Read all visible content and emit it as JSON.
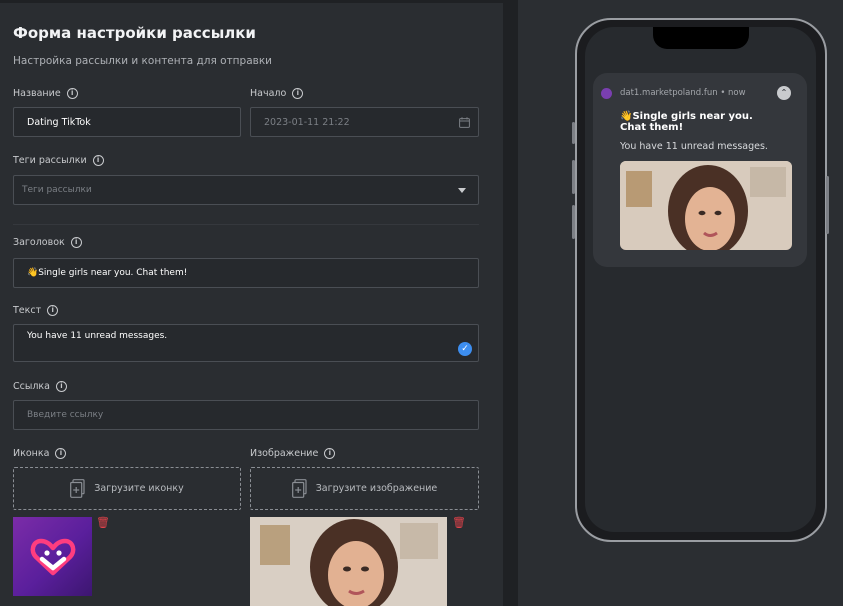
{
  "form": {
    "title": "Форма настройки рассылки",
    "subtitle": "Настройка рассылки и контента для отправки",
    "name_label": "Название",
    "name_value": "Dating TikTok",
    "start_label": "Начало",
    "start_placeholder": "2023-01-11 21:22",
    "tags_label": "Теги рассылки",
    "tags_placeholder": "Теги рассылки",
    "header_label": "Заголовок",
    "header_value": "👋Single girls near you. Chat them!",
    "text_label": "Текст",
    "text_value": "You have 11 unread messages.",
    "link_label": "Ссылка",
    "link_placeholder": "Введите ссылку",
    "icon_label": "Иконка",
    "icon_upload": "Загрузите иконку",
    "image_label": "Изображение",
    "image_upload": "Загрузите изображение"
  },
  "preview": {
    "source": "dat1.marketpoland.fun • now",
    "title": "👋Single girls near you. Chat them!",
    "body": "You have 11 unread messages."
  },
  "icons": {
    "info": "info-icon",
    "calendar": "calendar-icon",
    "dropdown": "chevron-down-icon",
    "upload": "document-upload-icon",
    "trash": "trash-icon",
    "collapse": "chevron-up-icon"
  },
  "colors": {
    "accent": "#3d8ef0",
    "danger": "#e2424a",
    "app_brand": "#7b2ca8"
  }
}
